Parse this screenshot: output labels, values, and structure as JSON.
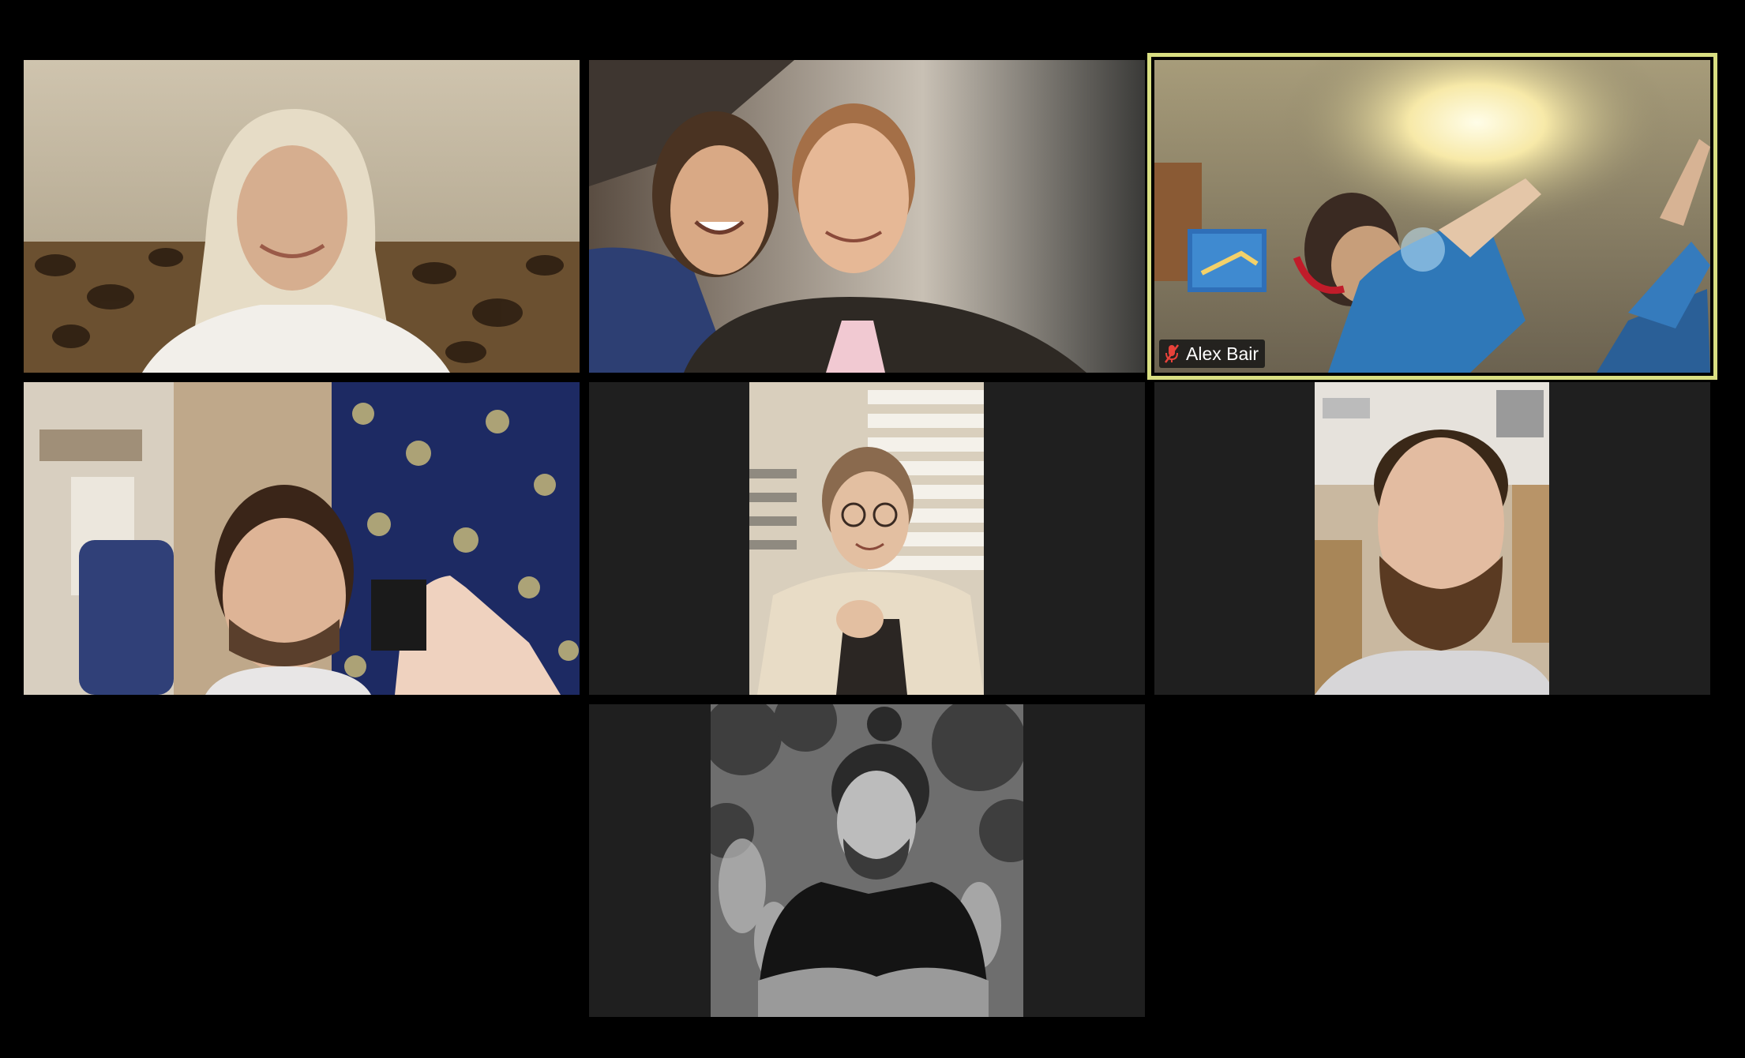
{
  "meeting": {
    "active_speaker": {
      "name": "Alex Bair",
      "mic_state": "muted",
      "mic_icon": "mic-muted-icon",
      "highlight_color": "#d9df82"
    },
    "colors": {
      "background": "#000000",
      "tile_bg": "#1f1f1f",
      "name_tag_bg": "#141414",
      "muted_icon": "#e8423a"
    }
  }
}
